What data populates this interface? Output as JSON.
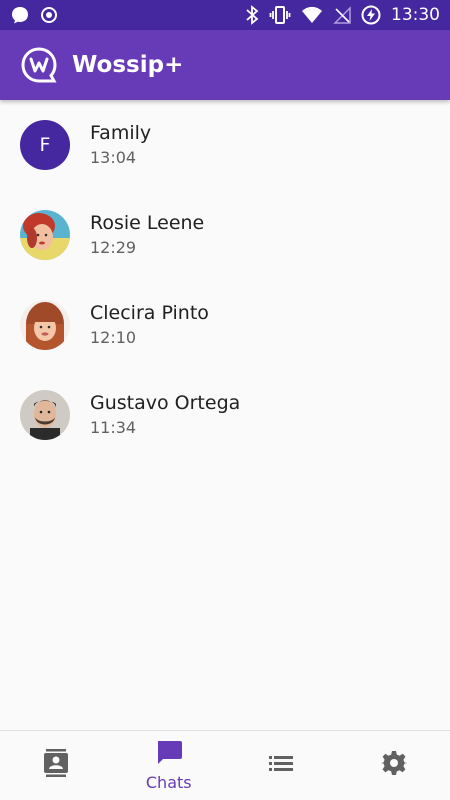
{
  "status_bar": {
    "time": "13:30",
    "icons": [
      "chat-bubble-icon",
      "record-icon",
      "bluetooth-icon",
      "vibrate-icon",
      "wifi-icon",
      "no-signal-icon",
      "battery-charging-icon"
    ]
  },
  "app_bar": {
    "title": "Wossip+",
    "logo": "wossip-logo",
    "color": "#673ab7",
    "status_color": "#4527a0"
  },
  "chats": [
    {
      "name": "Family",
      "time": "13:04",
      "avatar_letter": "F",
      "avatar_type": "letter"
    },
    {
      "name": "Rosie Leene",
      "time": "12:29",
      "avatar_type": "photo"
    },
    {
      "name": "Clecira Pinto",
      "time": "12:10",
      "avatar_type": "photo"
    },
    {
      "name": "Gustavo Ortega",
      "time": "11:34",
      "avatar_type": "photo"
    }
  ],
  "bottom_nav": {
    "items": [
      {
        "icon": "contacts-icon",
        "label": "",
        "active": false
      },
      {
        "icon": "chat-icon",
        "label": "Chats",
        "active": true
      },
      {
        "icon": "list-icon",
        "label": "",
        "active": false
      },
      {
        "icon": "settings-icon",
        "label": "",
        "active": false
      }
    ]
  }
}
